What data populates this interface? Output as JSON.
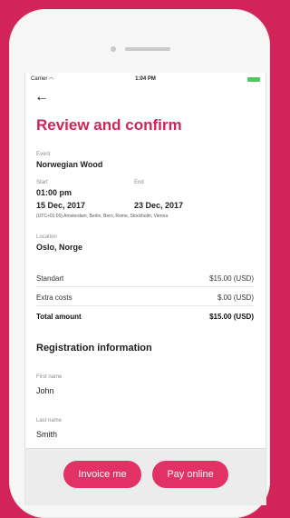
{
  "statusbar": {
    "carrier": "Carrier",
    "time": "1:04 PM"
  },
  "page": {
    "title": "Review and confirm"
  },
  "event": {
    "label": "Event",
    "value": "Norwegian Wood"
  },
  "start": {
    "label": "Start",
    "time": "01:00 pm",
    "date": "15 Dec, 2017"
  },
  "end": {
    "label": "End",
    "date": "23 Dec, 2017"
  },
  "timezone": "(UTC+01:00) Amsterdam, Berlin, Bern, Rome, Stockholm, Vienna",
  "location": {
    "label": "Location",
    "value": "Oslo, Norge"
  },
  "costs": [
    {
      "label": "Standart",
      "value": "$15.00 (USD)"
    },
    {
      "label": "Extra costs",
      "value": "$.00 (USD)"
    },
    {
      "label": "Total amount",
      "value": "$15.00 (USD)"
    }
  ],
  "registration": {
    "title": "Registration information",
    "first_name_label": "First name",
    "first_name": "John",
    "last_name_label": "Last name",
    "last_name": "Smith"
  },
  "actions": {
    "invoice": "Invoice me",
    "pay": "Pay online"
  },
  "colors": {
    "accent": "#d2235a",
    "button": "#e23165",
    "battery": "#52c75e"
  }
}
